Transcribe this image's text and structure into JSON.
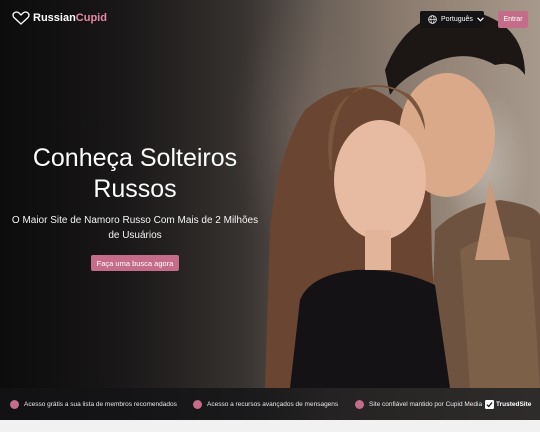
{
  "brand": {
    "name_part1": "Russian",
    "name_part2": "Cupid",
    "accent": "#c46c8a",
    "logo_icon": "heart-icon"
  },
  "header": {
    "language": "Português",
    "login_label": "Entrar"
  },
  "hero": {
    "headline_line1": "Conheça Solteiros",
    "headline_line2": "Russos",
    "subline": "O Maior Site de Namoro Russo Com Mais de 2 Milhões de Usuários",
    "cta_label": "Faça uma busca agora"
  },
  "features": [
    {
      "label": "Acesso grátis a sua lista de membros recomendados"
    },
    {
      "label": "Acesso a recursos avançados de mensagens"
    },
    {
      "label": "Site confiável mantido por Cupid Media"
    }
  ],
  "trusted_badge": "TrustedSite"
}
